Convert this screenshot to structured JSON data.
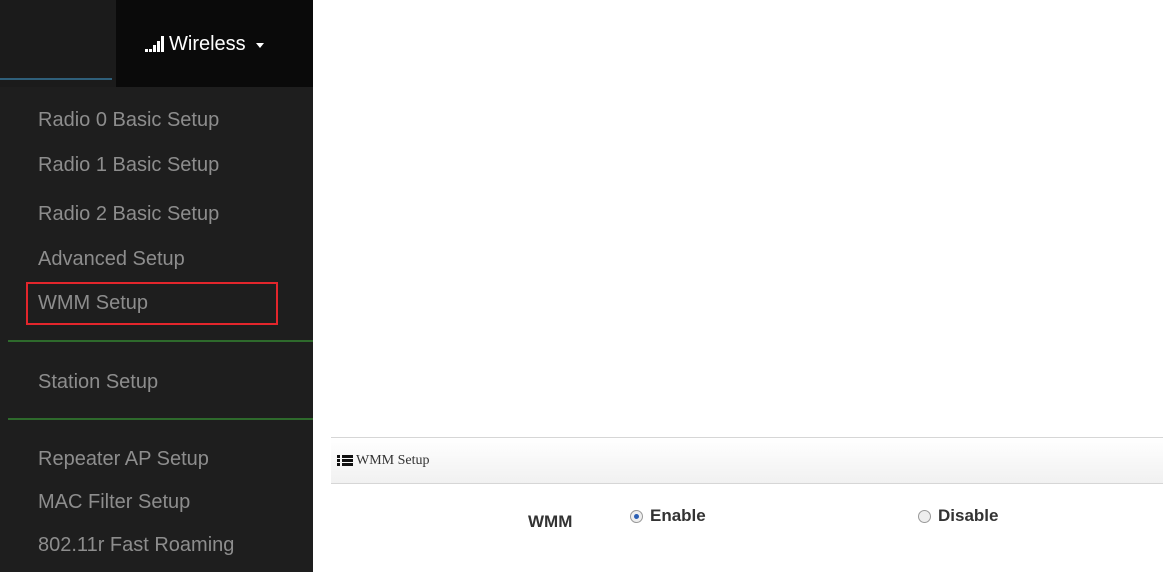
{
  "nav": {
    "menu_title": "Wireless",
    "items": [
      {
        "label": "Radio 0 Basic Setup"
      },
      {
        "label": "Radio 1 Basic Setup"
      },
      {
        "label": "Radio 2 Basic Setup"
      },
      {
        "label": "Advanced Setup"
      },
      {
        "label": "WMM Setup",
        "highlighted": true
      },
      {
        "label": "Station Setup"
      },
      {
        "label": "Repeater AP Setup"
      },
      {
        "label": "MAC Filter Setup"
      },
      {
        "label": "802.11r Fast Roaming"
      }
    ],
    "highlight_color": "#e3262c",
    "divider_color": "#2e6a2c"
  },
  "wmm_panel": {
    "title": "WMM Setup",
    "field_label": "WMM",
    "options": [
      {
        "label": "Enable",
        "selected": true
      },
      {
        "label": "Disable",
        "selected": false
      }
    ]
  }
}
